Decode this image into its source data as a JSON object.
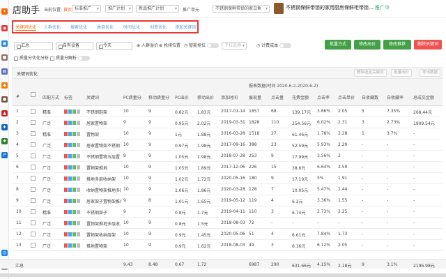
{
  "app": {
    "brand": "店助手"
  },
  "breadcrumb": {
    "prefix": "当前位置:",
    "home": "首页"
  },
  "top": {
    "sel1": "标准推广",
    "sel2": "推广计划",
    "sel3": "新品推广计划",
    "lbl": "推广单元",
    "sel4": "不锈钢保鲜带锁的家日鱼"
  },
  "product": {
    "name": "不锈钢保鲜带锁的家用厨房保鲜柜带锁...",
    "status": "推广中"
  },
  "tabs": [
    "关键词优化",
    "人群优化",
    "搜索优化",
    "类目优化",
    "时间优化",
    "创意优化",
    "添加关键词"
  ],
  "filters": {
    "plan": "汇总",
    "device": "自有设备",
    "date": "今天",
    "crowd_btn": "人群溢价",
    "rank_btn": "抢排位置",
    "smart": "智能抢位",
    "smart_val": "下拉选项",
    "count_cost": "计费成本",
    "batch_label": "批量方式",
    "bid_btn": "修改出价",
    "rec_btn": "修改推荐",
    "del_btn": "删除关键词",
    "opt1": "质量分优化分析",
    "opt2": "质量分解析"
  },
  "section": {
    "title": "关键词优化",
    "b1": "删除选定关键词",
    "b2": "批量出价",
    "b3": "导出数据"
  },
  "header": {
    "period": "报表数据(时间 2020-6-2-2020-6-2)",
    "cols": [
      "#",
      "",
      "匹配方式",
      "标签",
      "关键词",
      "PC质量分",
      "移动质量分",
      "PC出价",
      "移动出价",
      "添加时间",
      "展现量",
      "点击量",
      "花费金额",
      "点击率",
      "点击单价",
      "自收藏数",
      "自收藏率",
      "总成交金额"
    ]
  },
  "rows": [
    {
      "n": "1",
      "match": "精准",
      "kw": "不锈钢鞋架",
      "pcq": "10",
      "mq": "9",
      "pcb": "0.82元",
      "mb": "1.83元",
      "date": "2017-01-14",
      "imp": "1857",
      "clk": "68",
      "cost": "139.17元",
      "ctr": "3.66%",
      "cpc": "2.05",
      "fav": "5",
      "favr": "7.35%",
      "gmv": "268.44元"
    },
    {
      "n": "2",
      "match": "广泛",
      "kw": "居家置物架",
      "pcq": "9",
      "mq": "9",
      "pcb": "0.95元",
      "mb": "2.02元",
      "date": "2019-03-31",
      "imp": "1828",
      "clk": "110",
      "cost": "254.56元",
      "ctr": "6.02%",
      "cpc": "2.31",
      "fav": "3",
      "favr": "2.73%",
      "gmv": "1909.54元"
    },
    {
      "n": "3",
      "match": "精准",
      "kw": "置物架",
      "pcq": "10",
      "mq": "9",
      "pcb": "1元",
      "mb": "1.88元",
      "date": "2016-03-28",
      "imp": "1518",
      "clk": "27",
      "cost": "61.46元",
      "ctr": "1.78%",
      "cpc": "2.28",
      "fav": "1",
      "favr": "3.7%",
      "gmv": "-"
    },
    {
      "n": "4",
      "match": "广泛",
      "kw": "居家置物架不锈钢",
      "pcq": "10",
      "mq": "9",
      "pcb": "0.97元",
      "mb": "1.98元",
      "date": "2017-09-16",
      "imp": "388",
      "clk": "23",
      "cost": "52.59元",
      "ctr": "5.93%",
      "cpc": "2.29",
      "fav": "-",
      "favr": "-",
      "gmv": "-"
    },
    {
      "n": "5",
      "match": "广泛",
      "kw": "不锈钢置物五层置...",
      "pcq": "9",
      "mq": "9",
      "pcb": "1.05元",
      "mb": "1.98元",
      "date": "2018-07-28",
      "imp": "253",
      "clk": "9",
      "cost": "17.99元",
      "ctr": "3.56%",
      "cpc": "2",
      "fav": "-",
      "favr": "-",
      "gmv": "-"
    },
    {
      "n": "6",
      "match": "广泛",
      "kw": "置物架推地",
      "pcq": "10",
      "mq": "9",
      "pcb": "1.05元",
      "mb": "1.89元",
      "date": "2017-12-06",
      "imp": "226",
      "clk": "15",
      "cost": "38.6元",
      "ctr": "6.64%",
      "cpc": "2.59",
      "fav": "-",
      "favr": "-",
      "gmv": "-"
    },
    {
      "n": "7",
      "match": "广泛",
      "kw": "推地多层收纳架",
      "pcq": "10",
      "mq": "9",
      "pcb": "1.02元",
      "mb": "1.72元",
      "date": "2020-05-16",
      "imp": "180",
      "clk": "9",
      "cost": "17.19元",
      "ctr": "5%",
      "cpc": "1.91",
      "fav": "-",
      "favr": "-",
      "gmv": "-"
    },
    {
      "n": "8",
      "match": "广泛",
      "kw": "收纳置物架推地多层",
      "pcq": "10",
      "mq": "9",
      "pcb": "1.06元",
      "mb": "1.86元",
      "date": "2020-03-28",
      "imp": "128",
      "clk": "7",
      "cost": "10.05元",
      "ctr": "5.47%",
      "cpc": "1.44",
      "fav": "-",
      "favr": "-",
      "gmv": "-"
    },
    {
      "n": "9",
      "match": "广泛",
      "kw": "居家架子置物架推地",
      "pcq": "9",
      "mq": "8",
      "pcb": "1.01元",
      "mb": "1.65元",
      "date": "2019-05-12",
      "imp": "119",
      "clk": "4",
      "cost": "6.2元",
      "ctr": "3.36%",
      "cpc": "1.55",
      "fav": "-",
      "favr": "-",
      "gmv": "-"
    },
    {
      "n": "10",
      "match": "精准",
      "kw": "不锈钢架子",
      "pcq": "9",
      "mq": "7",
      "pcb": "0.8元",
      "mb": "1.7元",
      "date": "2019-04-11",
      "imp": "110",
      "clk": "3",
      "cost": "6.74元",
      "ctr": "2.73%",
      "cpc": "2.25",
      "fav": "-",
      "favr": "-",
      "gmv": "-"
    },
    {
      "n": "11",
      "match": "广泛",
      "kw": "置物架推地多层收...",
      "pcq": "10",
      "mq": "9",
      "pcb": "0.8元",
      "mb": "1.5元",
      "date": "2018-08-03",
      "imp": "72",
      "clk": "-",
      "cost": "-",
      "ctr": "-",
      "cpc": "-",
      "fav": "-",
      "favr": "-",
      "gmv": "-"
    },
    {
      "n": "12",
      "match": "广泛",
      "kw": "置物架收纳层架",
      "pcq": "10",
      "mq": "9",
      "pcb": "0.9元",
      "mb": "1.45元",
      "date": "2020-05-06",
      "imp": "51",
      "clk": "4",
      "cost": "6.61元",
      "ctr": "7.84%",
      "cpc": "1.73",
      "fav": "-",
      "favr": "-",
      "gmv": "-"
    },
    {
      "n": "13",
      "match": "广泛",
      "kw": "推地置物架",
      "pcq": "10",
      "mq": "9",
      "pcb": "0.9元",
      "mb": "1.62元",
      "date": "2018-08-03",
      "imp": "49",
      "clk": "3",
      "cost": "6.16元",
      "ctr": "6.12%",
      "cpc": "2.05",
      "fav": "-",
      "favr": "-",
      "gmv": "-"
    }
  ],
  "footer": {
    "label": "汇总",
    "pcq": "9.43",
    "mq": "8.48",
    "pcb": "0.67",
    "mb": "1.72",
    "imp": "6987",
    "clk": "290",
    "cost": "631.66元",
    "ctr": "4.15%",
    "cpc": "2.18元",
    "fav": "9",
    "favr": "3.1%",
    "gmv": "2196.98元"
  }
}
